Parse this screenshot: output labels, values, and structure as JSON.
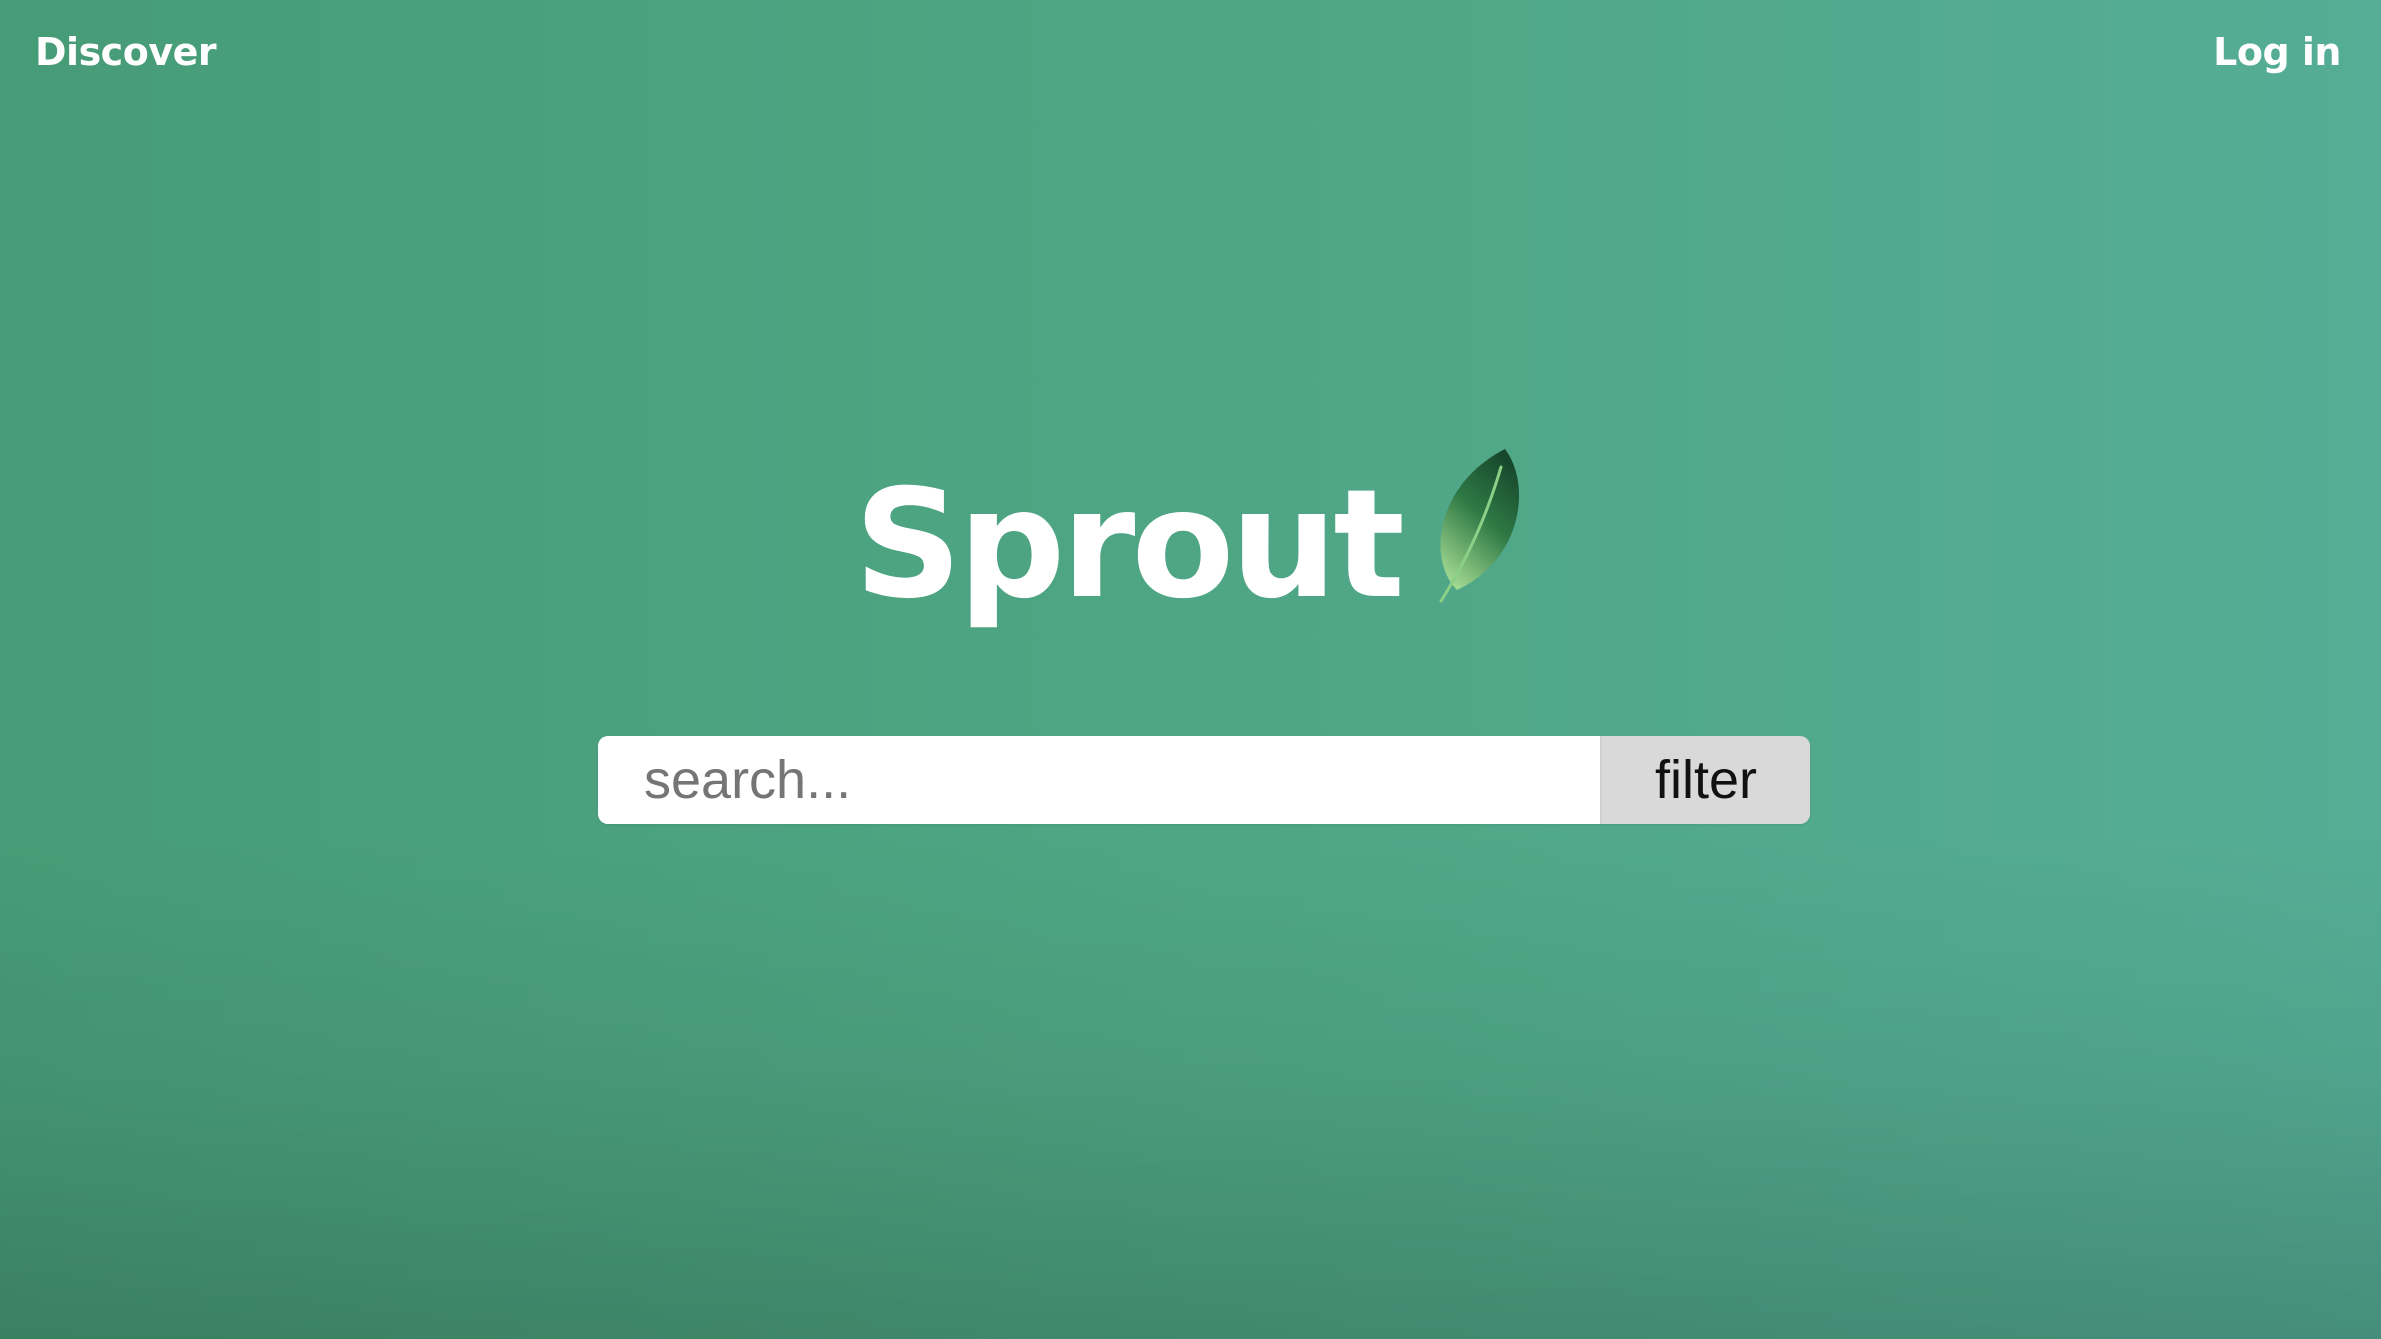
{
  "nav": {
    "discover_label": "Discover",
    "login_label": "Log in"
  },
  "brand": {
    "name": "Sprout",
    "icon": "leaf-icon"
  },
  "search": {
    "placeholder": "search...",
    "value": "",
    "filter_label": "filter"
  },
  "colors": {
    "background": "#4ea583",
    "text": "#ffffff",
    "filter_button": "#d9d9d9",
    "leaf_dark": "#1f5e3c",
    "leaf_light": "#8fd38c"
  }
}
